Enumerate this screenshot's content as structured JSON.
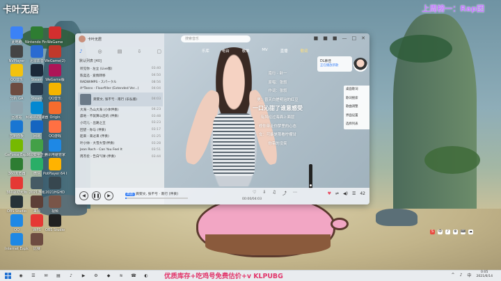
{
  "overlay": {
    "top_left": "卡叶无居",
    "top_right": "上周榜一：Rap团",
    "promo": "优质库存+吃鸡号免费估价+v KLPUBG"
  },
  "desktop_icons": [
    {
      "label": "此电脑",
      "color": "#3b82f6"
    },
    {
      "label": "Nintendo Fin 3D",
      "color": "#2e7d32"
    },
    {
      "label": "WeGame",
      "color": "#d32f2f"
    },
    {
      "label": "NVPlayer",
      "color": "#444"
    },
    {
      "label": "迅雷影音",
      "color": "#2a6bd1"
    },
    {
      "label": "WeGame(2)",
      "color": "#c0392b"
    },
    {
      "label": "QQ音乐",
      "color": "#f4c20d"
    },
    {
      "label": "Steam",
      "color": "#1b2838"
    },
    {
      "label": "WeGame版",
      "color": "#ad1457"
    },
    {
      "label": "分析 GA",
      "color": "#6d4c41"
    },
    {
      "label": "Steam",
      "color": "#26374a"
    },
    {
      "label": "QQ音乐",
      "color": "#f4b400"
    },
    {
      "label": "回收站",
      "color": "#90a4ae"
    },
    {
      "label": "网易UU加速器",
      "color": "#0288d1"
    },
    {
      "label": "Origin",
      "color": "#f56c2d"
    },
    {
      "label": "控制面板",
      "color": "#1976d2"
    },
    {
      "label": "网易",
      "color": "#1565c0"
    },
    {
      "label": "QQ游戏",
      "color": "#ff7043"
    },
    {
      "label": "GeForce Experience",
      "color": "#76b900"
    },
    {
      "label": "360安全卫士",
      "color": "#43a047"
    },
    {
      "label": "腾讯电脑管家",
      "color": "#1e88e5"
    },
    {
      "label": "360浏览器",
      "color": "#2e7d32"
    },
    {
      "label": "微信",
      "color": "#2aae67"
    },
    {
      "label": "PotPlayer 64 bit",
      "color": "#ffb300"
    },
    {
      "label": "360驱动大师",
      "color": "#e53935"
    },
    {
      "label": "2021游戏",
      "color": "#455a64"
    },
    {
      "label": "2021HGHD",
      "color": "#37474f"
    },
    {
      "label": "OBS Studio",
      "color": "#263238"
    },
    {
      "label": "来源",
      "color": "#5d4037"
    },
    {
      "label": "视频",
      "color": "#795548"
    },
    {
      "label": "QQ",
      "color": "#1e88e5"
    },
    {
      "label": "WPS",
      "color": "#e53935"
    },
    {
      "label": "OBS Studio",
      "color": "#212121"
    },
    {
      "label": "Internet Explorer",
      "color": "#1e88e5"
    },
    {
      "label": "比赛",
      "color": "#6d4c41"
    }
  ],
  "player": {
    "username": "卡叶无居",
    "search_placeholder": "搜索音乐",
    "window_buttons": [
      "■",
      "■",
      "■",
      "—",
      "□",
      "✕"
    ],
    "nav_icons": [
      "♪",
      "◎",
      "▤",
      "⇩",
      "▢"
    ],
    "list_title": "默认列表 [40]",
    "songs": [
      {
        "title": "听见你 · 左立 (Live版)",
        "dur": "03:40"
      },
      {
        "title": "陈奕迅 · 爱情转移",
        "dur": "04:50"
      },
      {
        "title": "RADWIMPS - スパークル",
        "dur": "08:56"
      },
      {
        "title": "A*Teens - Floorfiller (Extended Ver...)",
        "dur": "04:04"
      },
      {
        "title": "龚婴文, 张不亏 - 南行 (乐弘版)",
        "dur": "04:03",
        "active": true
      },
      {
        "title": "大海 - 乃山大海 (小体伴奏)",
        "dur": "04:23"
      },
      {
        "title": "晨地 - 不就算以后的 (伴奏)",
        "dur": "03:48"
      },
      {
        "title": "小可儿 - 出路之王",
        "dur": "03:23"
      },
      {
        "title": "回望 - 你与 (伴奏)",
        "dur": "03:17"
      },
      {
        "title": "起来 - 来过来 (伴奏)",
        "dur": "01:25"
      },
      {
        "title": "叶小帅 - 大雪大雪(伴奏)",
        "dur": "03:28"
      },
      {
        "title": "Jean Roch - Can You Feel It",
        "dur": "03:51"
      },
      {
        "title": "周杰伦 - 告白气球 (伴奏)",
        "dur": "03:44"
      }
    ],
    "tabs": [
      {
        "label": "乐库",
        "on": false
      },
      {
        "label": "电台",
        "on": false
      },
      {
        "label": "歌单",
        "on": false
      },
      {
        "label": "MV",
        "on": false
      },
      {
        "label": "直播",
        "on": false
      },
      {
        "label": "歌词",
        "on": true
      }
    ],
    "follow": {
      "name": "DL慕佳",
      "sub": "正在播放新歌"
    },
    "lyrics": [
      "南行 - 卧一",
      "原唱：张叙",
      "作词：张叙",
      "男：曾天白搓明治的红豆",
      "一口沁甜了谁意感受",
      "有风经过海面上面层",
      "修你带走你梦里的心态",
      "女：可能是那看柠檬甘",
      "你带的没笑"
    ],
    "current_lyric_index": 4,
    "side_menu": [
      "桌面歌词",
      "歌词搜索",
      "歌曲调整",
      "界面设置",
      "选择列表"
    ],
    "now_playing": "龚婴文, 张不亏 · 南行 (伴奏)",
    "quality": "高品",
    "time": "00:00/04:03",
    "progress": 0.02,
    "volume_count": "42",
    "controls": [
      "◀",
      "❚❚",
      "▶"
    ],
    "tools": [
      "♡",
      "⇩",
      "♫",
      "⤴",
      "⋯"
    ],
    "right_tools": [
      "♥",
      "⇌",
      "◀)",
      "☰"
    ]
  },
  "tray": [
    "S",
    "中",
    "♪",
    "⚙",
    "⌨",
    "☁"
  ],
  "taskbar": {
    "apps": [
      "◉",
      "☰",
      "✉",
      "▤",
      "♪",
      "▶",
      "⚙",
      "◆",
      "≋",
      "☎",
      "◐"
    ],
    "clock_time": "0:05",
    "clock_date": "2021/6/14",
    "right_icons": [
      "^",
      "♪",
      "中"
    ]
  }
}
